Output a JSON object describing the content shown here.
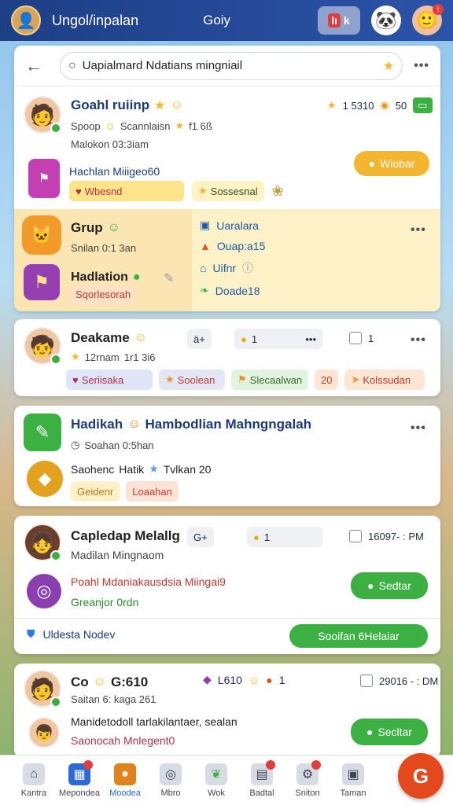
{
  "topbar": {
    "title": "Ungol/inpalan",
    "subtitle": "Goiy",
    "btn_label": "lı",
    "btn_badge": "k"
  },
  "search": {
    "value": "Uapialmard Ndatians mingniail"
  },
  "card1": {
    "name": "Goahl ruiinp",
    "line1": "Spoop",
    "line1b": "Scannlaisn",
    "line1c": "f1 6ß",
    "line2": "Malokon 03:3iam",
    "group_title": "Hachlan Miiigeo60",
    "chip1": "Wbesnd",
    "chip2": "Sossesnal",
    "right_stat": "1 5310",
    "right_stat2": "50",
    "action": "Wiobar"
  },
  "group": {
    "left1_title": "Grup",
    "left1_sub": "Snilan 0:1 3an",
    "left2_title": "Hadlation",
    "left2_sub": "Sqorlesorah",
    "right1": "Uaralara",
    "right2": "Ouap:a15",
    "right3": "Uifnr",
    "right4": "Doade18"
  },
  "card2": {
    "name": "Deakame",
    "stat": "12rnam",
    "stat2": "1r1 3i6",
    "pill1": "ä+",
    "pill2": "1",
    "pill3": "1",
    "chip1": "Seriisaka",
    "chip2": "Soolean",
    "chip3": "Slecaalwan",
    "chip4": "20",
    "chip5": "Kolssudan"
  },
  "card3": {
    "title": "Hadikah",
    "title2": "Hambodlian Mahngngalah",
    "sub": "Soahan 0:5han",
    "line": "Saohenc",
    "line_b": "Hatik",
    "line_c": "Tvlkan 20",
    "chip1": "Geidenr",
    "chip2": "Loaahan"
  },
  "card4": {
    "name": "Capledap Melallg",
    "sub": "Madilan Mingnaom",
    "pill1": "G+",
    "pill2": "1",
    "date": "16097- : PM",
    "line_red": "Poahl Mdaniakausdsia Miingai9",
    "line_green": "Greanjor 0rdn",
    "action": "Sedtar",
    "footer_text": "Uldesta Nodev",
    "footer_btn": "Sooifan 6Helaiar"
  },
  "card5": {
    "name": "Co",
    "name2": "G:610",
    "sub": "Saitan 6: kaga 261",
    "stat": "L610",
    "stat2": "1",
    "date": "29016 - : DM",
    "msg": "Manidetodoll tarlakilantaer, sealan",
    "msg2": "Saonocah Mnlegent0",
    "action": "Secltar"
  },
  "nav": [
    {
      "label": "Kantra"
    },
    {
      "label": "Mepondea"
    },
    {
      "label": "Moodea"
    },
    {
      "label": "Mbro"
    },
    {
      "label": "Wok"
    },
    {
      "label": "Badtal"
    },
    {
      "label": "Sniton"
    },
    {
      "label": "Taman"
    }
  ],
  "colors": {
    "accent": "#3cb043",
    "topbar": "#1e3f86",
    "fab": "#e24a1e"
  }
}
